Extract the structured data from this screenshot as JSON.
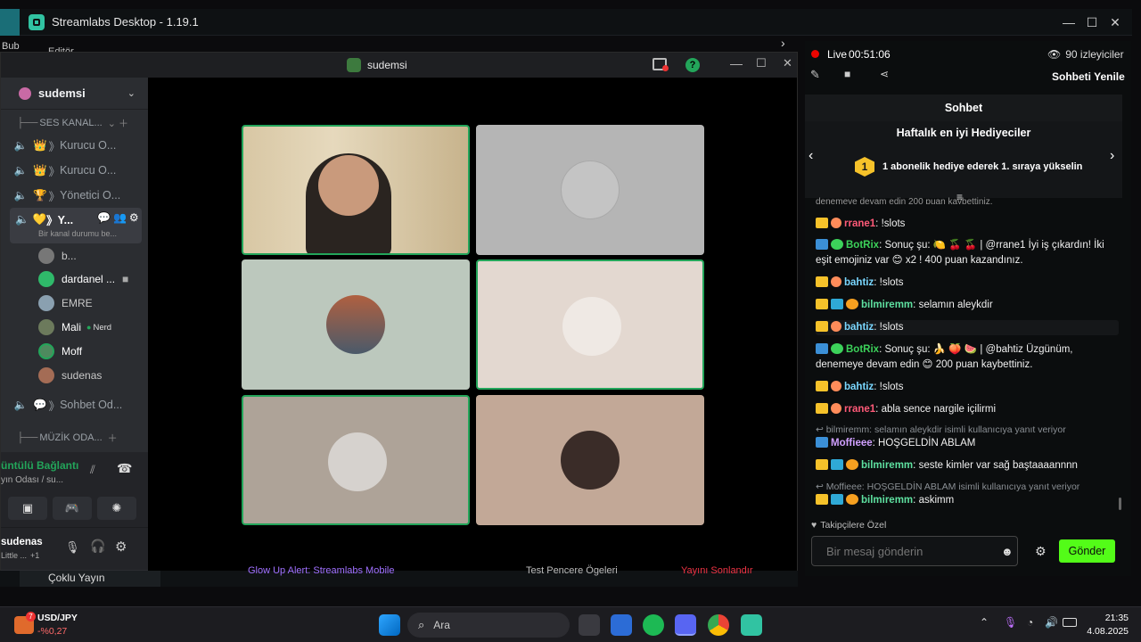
{
  "app": {
    "title": "Streamlabs Desktop - 1.19.1",
    "editor_label": "Editör",
    "side_label": "Bub"
  },
  "discord": {
    "window_title": "sudemsi",
    "server_name": "sudemsi",
    "channels": [
      {
        "label": "SES KANAL...",
        "type": "category"
      },
      {
        "label": "Kurucu O...",
        "type": "voice",
        "prefix": "👑"
      },
      {
        "label": "Kurucu O...",
        "type": "voice",
        "prefix": "👑"
      },
      {
        "label": "Yönetici O...",
        "type": "voice",
        "prefix": "🏆"
      },
      {
        "label": "Y...",
        "type": "voice-active",
        "prefix": "💛"
      },
      {
        "label": "Sohbet Od...",
        "type": "voice",
        "prefix": "💬"
      },
      {
        "label": "MÜZİK ODA...",
        "type": "category"
      }
    ],
    "channel_status": "Bir kanal durumu be...",
    "members": [
      {
        "name": "b...",
        "color": "#777777"
      },
      {
        "name": "dardanel ...",
        "color": "#2fb96a"
      },
      {
        "name": "EMRE",
        "color": "#8aa0b0"
      },
      {
        "name": "Mali",
        "color": "#6c7a5c",
        "tag": "Nerd"
      },
      {
        "name": "Moff",
        "color": "#4e8a5e"
      },
      {
        "name": "sudenas",
        "color": "#a46c55"
      }
    ],
    "voice_status": "üntülü Bağlantı",
    "voice_sub": "yın Odası / su...",
    "self_user": "sudenas",
    "self_status": "Little ...",
    "self_extra": "+1"
  },
  "streamlabs": {
    "multi_stream": "Çoklu Yayın",
    "ticker_alert": "Glow Up Alert: Streamlabs Mobile",
    "ticker_test": "Test Pencere Ögeleri",
    "ticker_end": "Yayını Sonlandır"
  },
  "chat": {
    "live_label": "Live",
    "live_time": "00:51:06",
    "viewers": "90 izleyiciler",
    "refresh": "Sohbeti Yenile",
    "tab": "Sohbet",
    "gifters_title": "Haftalık en iyi Hediyeciler",
    "gifter_rank": "1",
    "gifter_text": "1 abonelik hediye ederek 1. sıraya yükselin",
    "cut_text": "denemeye devam edin 200 puan kaybettiniz.",
    "messages": [
      {
        "user": "rrane1",
        "color": "#ff5a78",
        "text": "!slots"
      },
      {
        "user": "BotRix",
        "color": "#3cd25a",
        "text": "Sonuç şu: 🍋 🍒 🍒 | @rrane1 İyi iş çıkardın! İki eşit emojiniz var 😊 x2 ! 400 puan kazandınız."
      },
      {
        "user": "bahtiz",
        "color": "#7ad7ff",
        "text": "!slots"
      },
      {
        "user": "bilmiremm",
        "color": "#5ee0a0",
        "text": "selamın aleykdir"
      },
      {
        "user": "bahtiz",
        "color": "#7ad7ff",
        "text": "!slots"
      },
      {
        "user": "BotRix",
        "color": "#3cd25a",
        "text": "Sonuç şu: 🍌 🍑 🍉 | @bahtiz Üzgünüm, denemeye devam edin 😊 200 puan kaybettiniz."
      },
      {
        "user": "bahtiz",
        "color": "#7ad7ff",
        "text": "!slots"
      },
      {
        "user": "rrane1",
        "color": "#ff5a78",
        "text": "abla sence nargile içilirmi"
      },
      {
        "user": "Moffieee",
        "color": "#d0a0ff",
        "text": "HOŞGELDİN ABLAM",
        "reply": "bilmiremm: selamın aleykdir isimli kullanıcıya yanıt veriyor"
      },
      {
        "user": "bilmiremm",
        "color": "#5ee0a0",
        "text": "seste kimler var sağ baştaaaannnn"
      },
      {
        "user": "bilmiremm",
        "color": "#5ee0a0",
        "text": "askimm",
        "reply": "Moffieee: HOŞGELDİN ABLAM isimli kullanıcıya yanıt veriyor"
      }
    ],
    "followers_only": "Takipçilere Özel",
    "input_placeholder": "Bir mesaj gönderin",
    "send_label": "Gönder"
  },
  "taskbar": {
    "ticker_symbol": "USD/JPY",
    "ticker_change": "-%0,27",
    "ticker_badge": "7",
    "search_label": "Ara",
    "time": "21:35",
    "date": "4.08.2025"
  },
  "colors": {
    "accent_green": "#53fc18",
    "discord_green": "#23a55a",
    "live_red": "#eb0400"
  }
}
